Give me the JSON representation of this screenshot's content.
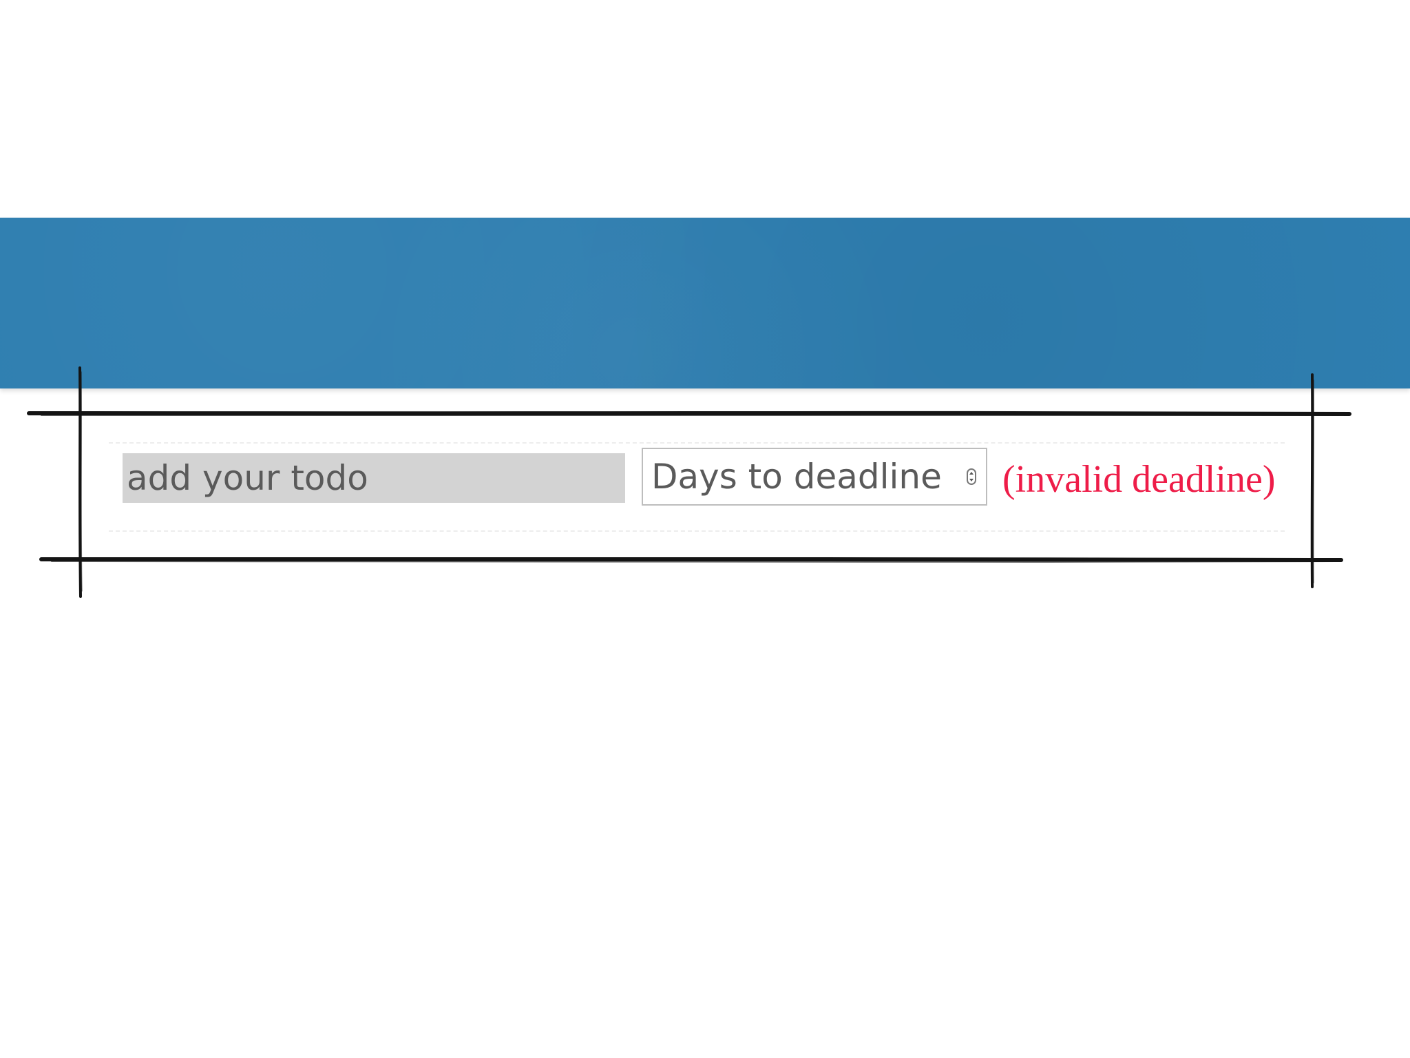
{
  "banner": {
    "color": "#2e7eb0"
  },
  "form": {
    "todo_placeholder": "add your todo",
    "deadline_select_label": "Days to deadline",
    "deadline_select_icon": "stepper-arrows-icon",
    "error_message": "(invalid deadline)",
    "error_color": "#ee1c48"
  }
}
